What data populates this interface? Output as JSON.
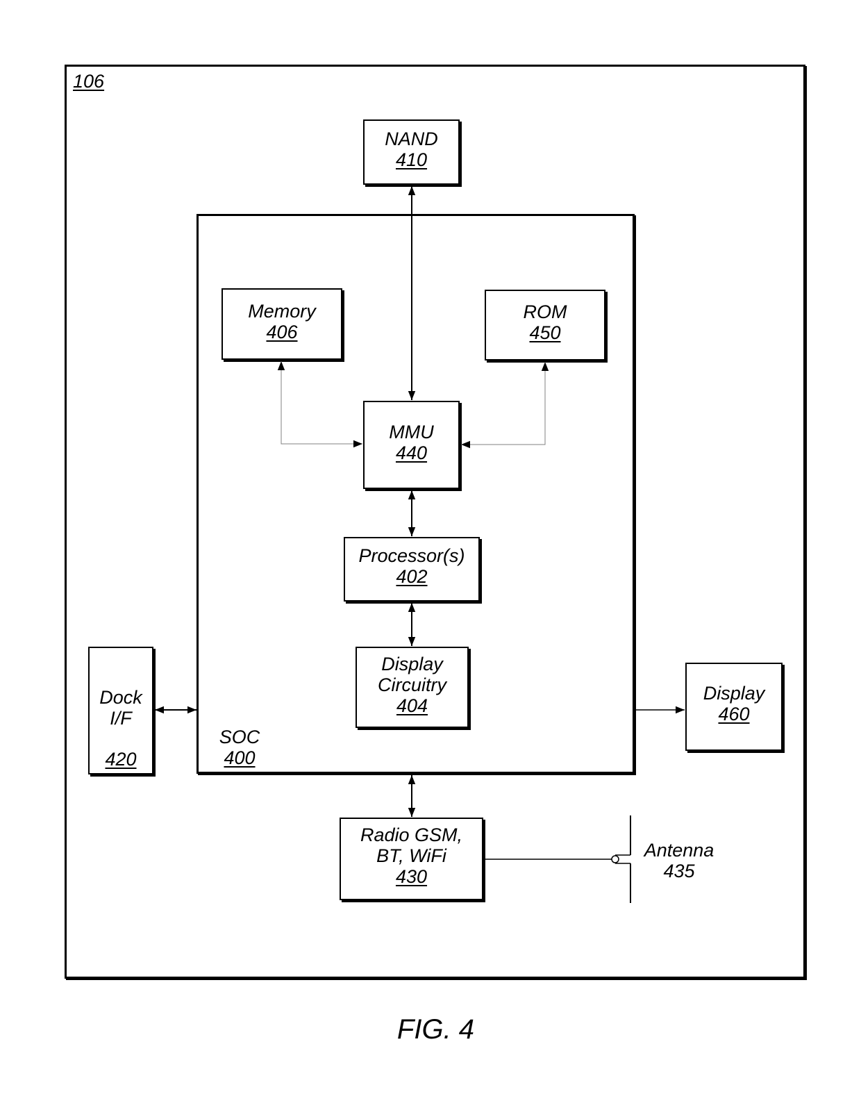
{
  "figure": {
    "caption": "FIG. 4",
    "device_ref": "106"
  },
  "blocks": {
    "nand": {
      "name": "NAND",
      "ref": "410"
    },
    "soc": {
      "name": "SOC",
      "ref": "400"
    },
    "memory": {
      "name": "Memory",
      "ref": "406"
    },
    "rom": {
      "name": "ROM",
      "ref": "450"
    },
    "mmu": {
      "name": "MMU",
      "ref": "440"
    },
    "processor": {
      "name": "Processor(s)",
      "ref": "402"
    },
    "display_circuitry": {
      "name_line1": "Display",
      "name_line2": "Circuitry",
      "ref": "404"
    },
    "dock": {
      "name_line1": "Dock",
      "name_line2": "I/F",
      "ref": "420"
    },
    "display": {
      "name": "Display",
      "ref": "460"
    },
    "radio": {
      "name_line1": "Radio GSM,",
      "name_line2": "BT, WiFi",
      "ref": "430"
    },
    "antenna": {
      "name": "Antenna",
      "ref": "435"
    }
  },
  "connections": [
    {
      "from": "NAND 410",
      "to": "MMU 440",
      "type": "bidirectional"
    },
    {
      "from": "Memory 406",
      "to": "MMU 440",
      "type": "bidirectional"
    },
    {
      "from": "ROM 450",
      "to": "MMU 440",
      "type": "bidirectional"
    },
    {
      "from": "MMU 440",
      "to": "Processor(s) 402",
      "type": "bidirectional"
    },
    {
      "from": "Processor(s) 402",
      "to": "Display Circuitry 404",
      "type": "bidirectional"
    },
    {
      "from": "Dock I/F 420",
      "to": "SOC 400",
      "type": "bidirectional"
    },
    {
      "from": "SOC 400",
      "to": "Display 460",
      "type": "unidirectional"
    },
    {
      "from": "SOC 400",
      "to": "Radio 430",
      "type": "bidirectional"
    },
    {
      "from": "Radio 430",
      "to": "Antenna 435",
      "type": "line"
    }
  ]
}
